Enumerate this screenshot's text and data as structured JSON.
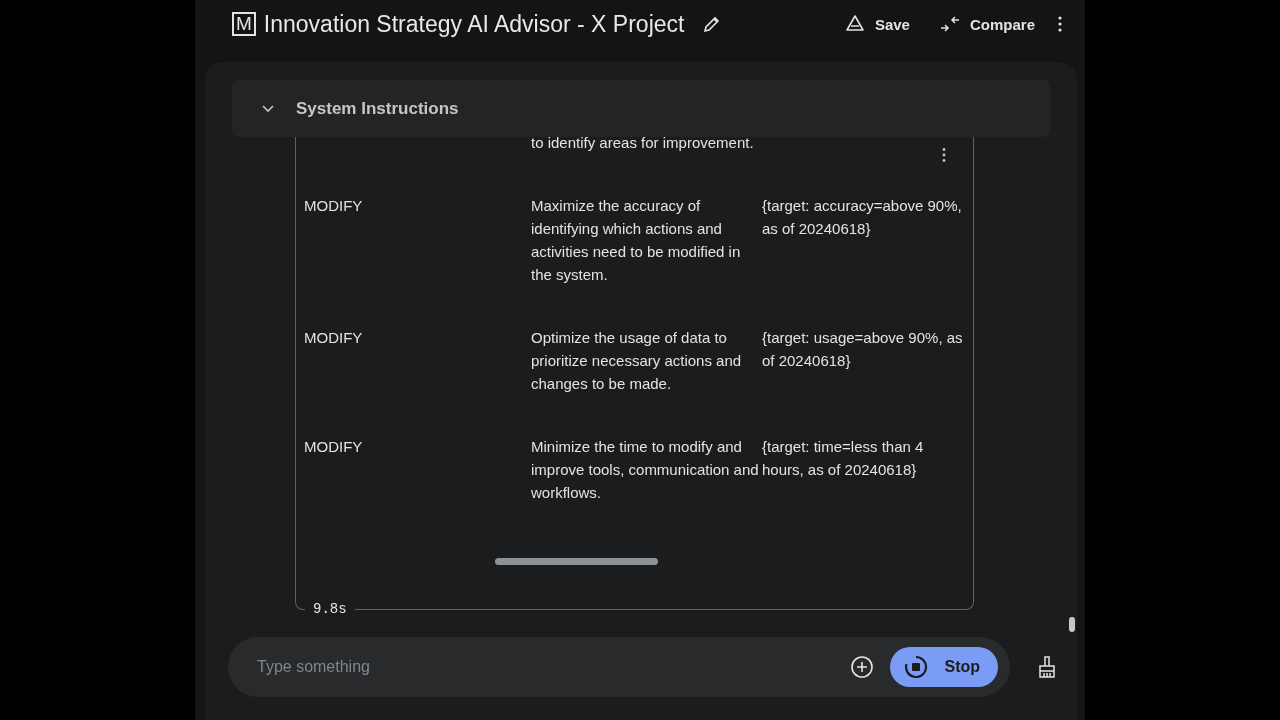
{
  "header": {
    "logo": "M",
    "title": "Innovation Strategy AI Advisor - X Project",
    "actions": [
      {
        "kind": "save",
        "label": "Save"
      },
      {
        "kind": "compare",
        "label": "Compare"
      }
    ]
  },
  "section": {
    "title": "System Instructions"
  },
  "table": {
    "rows": [
      {
        "column_2": "to identify areas for improvement."
      },
      {
        "column_1": "MODIFY",
        "column_2": "Maximize the accuracy of identifying which actions and activities need to be modified in the system.",
        "column_3": "{target: accuracy=above 90%, as of 20240618}"
      },
      {
        "column_1": "MODIFY",
        "column_2": "Optimize the usage of data to prioritize necessary actions and changes to be made.",
        "column_3": "{target: usage=above 90%, as of 20240618}"
      },
      {
        "column_1": "MODIFY",
        "column_2": "Minimize the time to modify and improve tools, communication and workflows.",
        "column_3": "{target: time=less than 4 hours, as of 20240618}"
      }
    ]
  },
  "elapsed": "9.8s",
  "composer": {
    "placeholder": "Type something",
    "stop_label": "Stop"
  }
}
